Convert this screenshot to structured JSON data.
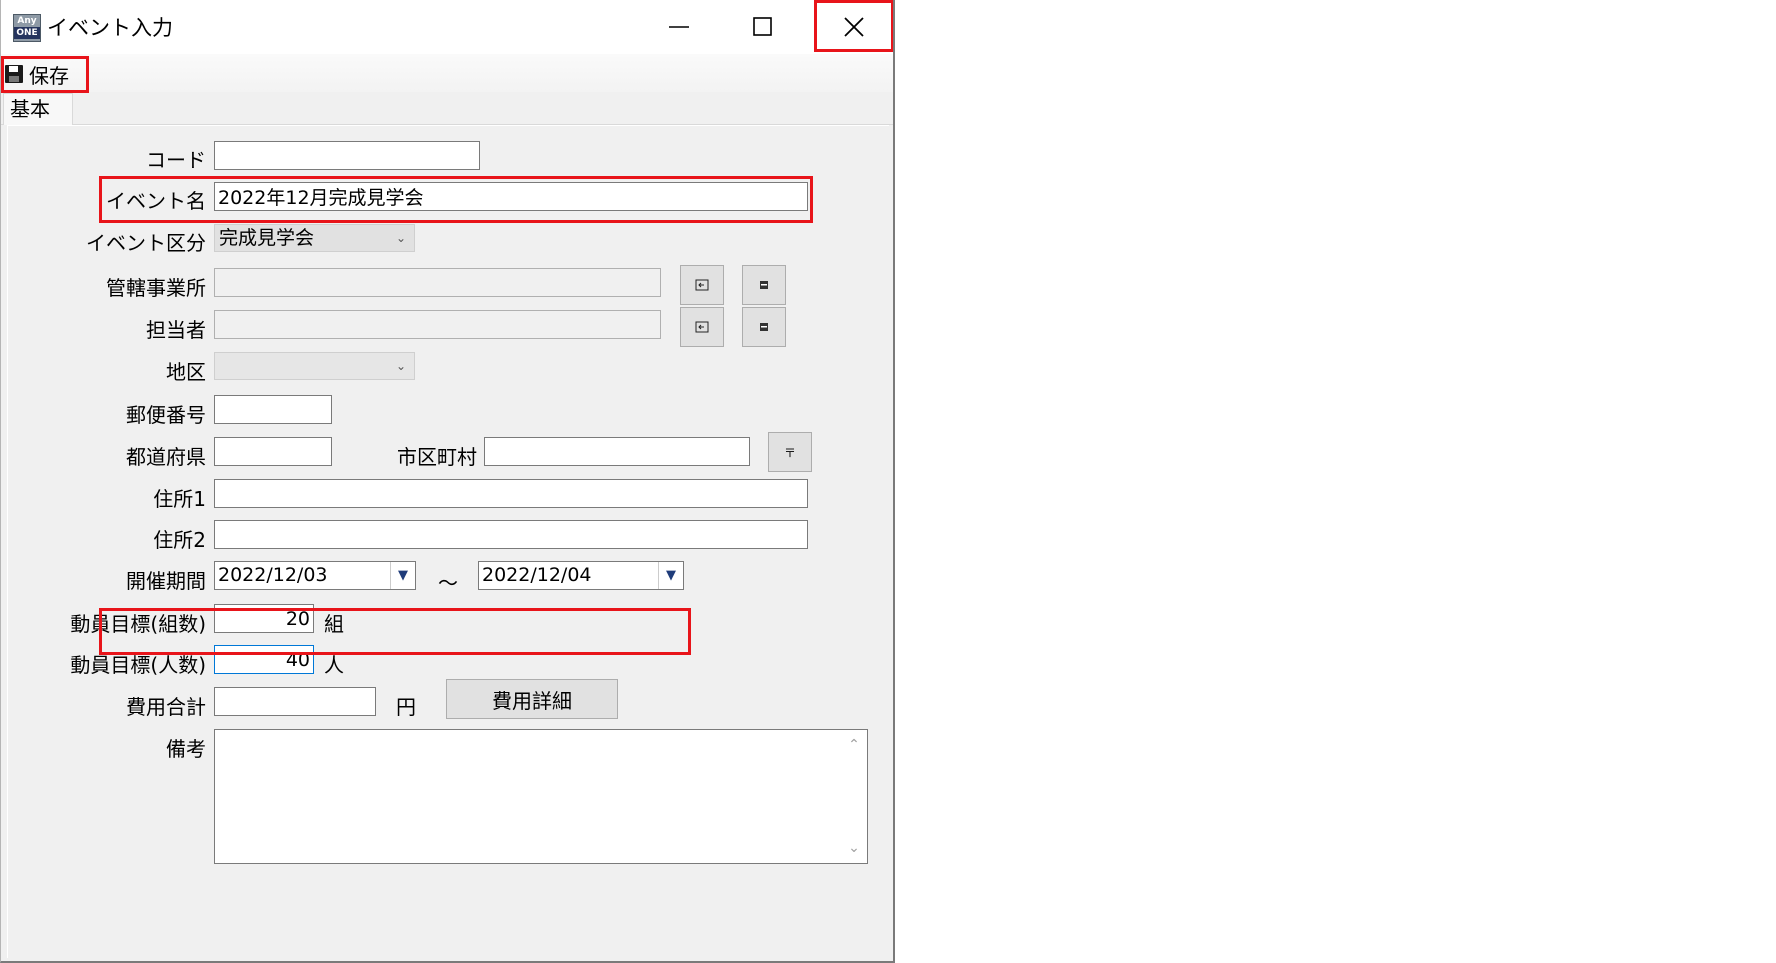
{
  "window": {
    "title": "イベント入力",
    "app_icon_line1": "Any",
    "app_icon_line2": "ONE"
  },
  "toolbar": {
    "save_label": "保存"
  },
  "tabs": [
    {
      "label": "基本"
    }
  ],
  "form": {
    "code": {
      "label": "コード",
      "value": ""
    },
    "event_name": {
      "label": "イベント名",
      "value": "2022年12月完成見学会"
    },
    "event_type": {
      "label": "イベント区分",
      "value": "完成見学会"
    },
    "office": {
      "label": "管轄事業所",
      "value": ""
    },
    "staff": {
      "label": "担当者",
      "value": ""
    },
    "district": {
      "label": "地区",
      "value": ""
    },
    "postal_code": {
      "label": "郵便番号",
      "value": ""
    },
    "prefecture": {
      "label": "都道府県",
      "value": ""
    },
    "city": {
      "label": "市区町村",
      "value": ""
    },
    "address1": {
      "label": "住所1",
      "value": ""
    },
    "address2": {
      "label": "住所2",
      "value": ""
    },
    "period": {
      "label": "開催期間",
      "start": "2022/12/03",
      "end": "2022/12/04",
      "separator": "～"
    },
    "target_groups": {
      "label": "動員目標(組数)",
      "value": "20",
      "unit": "組"
    },
    "target_people": {
      "label": "動員目標(人数)",
      "value": "40",
      "unit": "人"
    },
    "total_cost": {
      "label": "費用合計",
      "value": "",
      "unit": "円"
    },
    "cost_detail_button": "費用詳細",
    "notes": {
      "label": "備考",
      "value": ""
    }
  },
  "colors": {
    "highlight": "#e8141a",
    "window_bg": "#f0f0f0",
    "focus_border": "#0078d7"
  }
}
